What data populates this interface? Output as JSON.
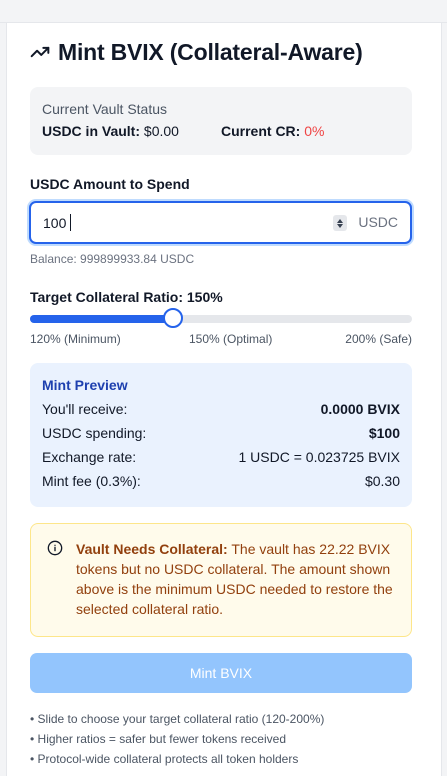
{
  "title": "Mint BVIX (Collateral-Aware)",
  "vault_status": {
    "heading": "Current Vault Status",
    "usdc_label": "USDC in Vault:",
    "usdc_value": "$0.00",
    "cr_label": "Current CR:",
    "cr_value": "0%",
    "cr_color": "#ef4444"
  },
  "amount": {
    "label": "USDC Amount to Spend",
    "value": "100",
    "unit": "USDC",
    "balance": "Balance: 999899933.84 USDC"
  },
  "ratio": {
    "label": "Target Collateral Ratio: 150%",
    "min": 120,
    "max": 200,
    "value": 150,
    "min_label": "120% (Minimum)",
    "mid_label": "150% (Optimal)",
    "max_label": "200% (Safe)"
  },
  "preview": {
    "heading": "Mint Preview",
    "rows": [
      {
        "label": "You'll receive:",
        "value": "0.0000 BVIX"
      },
      {
        "label": "USDC spending:",
        "value": "$100"
      },
      {
        "label": "Exchange rate:",
        "value": "1 USDC = 0.023725 BVIX"
      },
      {
        "label": "Mint fee (0.3%):",
        "value": "$0.30"
      }
    ]
  },
  "warning": {
    "title": "Vault Needs Collateral:",
    "body": " The vault has 22.22 BVIX tokens but no USDC collateral. The amount shown above is the minimum USDC needed to restore the selected collateral ratio."
  },
  "mint_button": "Mint BVIX",
  "notes": [
    "• Slide to choose your target collateral ratio (120-200%)",
    "• Higher ratios = safer but fewer tokens received",
    "• Protocol-wide collateral protects all token holders"
  ],
  "colors": {
    "accent": "#2563eb",
    "button_disabled": "#93c5fd",
    "warning_text": "#92400e"
  },
  "icons": [
    "trending-up-icon",
    "info-icon",
    "spinner-icon"
  ]
}
